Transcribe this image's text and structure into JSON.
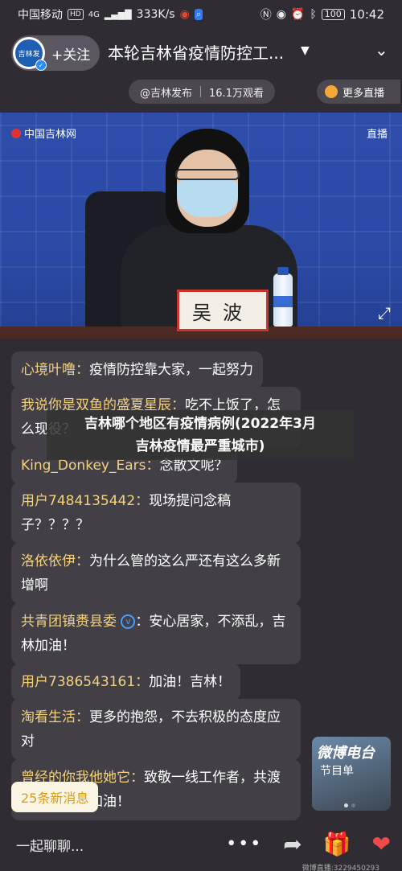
{
  "status": {
    "carrier": "中国移动",
    "hd": "HD",
    "network": "4G",
    "speed": "333K/s",
    "battery": "100",
    "time": "10:42"
  },
  "header": {
    "logo_text": "吉林发",
    "follow_label": "+关注",
    "title": "本轮吉林省疫情防控工...",
    "author": "@吉林发布",
    "views": "16.1万观看",
    "more_live": "更多直播"
  },
  "video": {
    "watermark": "中国吉林网",
    "live_tag": "直播",
    "nameplate": "吴波"
  },
  "overlay": {
    "line1": "吉林哪个地区有疫情病例(2022年3月",
    "line2": "吉林疫情最严重城市)"
  },
  "comments": [
    {
      "name": "心境叶噜：",
      "text": "疫情防控靠大家，一起努力"
    },
    {
      "name": "我说你是双鱼的盛夏星辰：",
      "text": "吃不上饭了，怎么现役？"
    },
    {
      "name": "King_Donkey_Ears：",
      "text": "念散文呢？"
    },
    {
      "name": "用户7484135442：",
      "text": "现场提问念稿子？？？？"
    },
    {
      "name": "洛依依伊：",
      "text": "为什么管的这么严还有这么多新增啊"
    },
    {
      "name": "共青团镇赉县委",
      "text": "：安心居家，不添乱，吉林加油！"
    },
    {
      "name": "用户7386543161：",
      "text": "加油！吉林！"
    },
    {
      "name": "淘看生活：",
      "text": "更多的抱怨，不去积极的态度应对"
    },
    {
      "name": "曾经的你我他她它：",
      "text": "致敬一线工作者，共渡难关，吉林加油！"
    }
  ],
  "ad": {
    "title": "微博电台",
    "subtitle": "节目单"
  },
  "new_messages": "25条新消息",
  "bottom": {
    "input_placeholder": "一起聊聊...",
    "room_id": "微博直播:3229450293"
  },
  "colors": {
    "background": "#2f2c34",
    "name": "#f5d37b",
    "bubble": "#423f47"
  }
}
